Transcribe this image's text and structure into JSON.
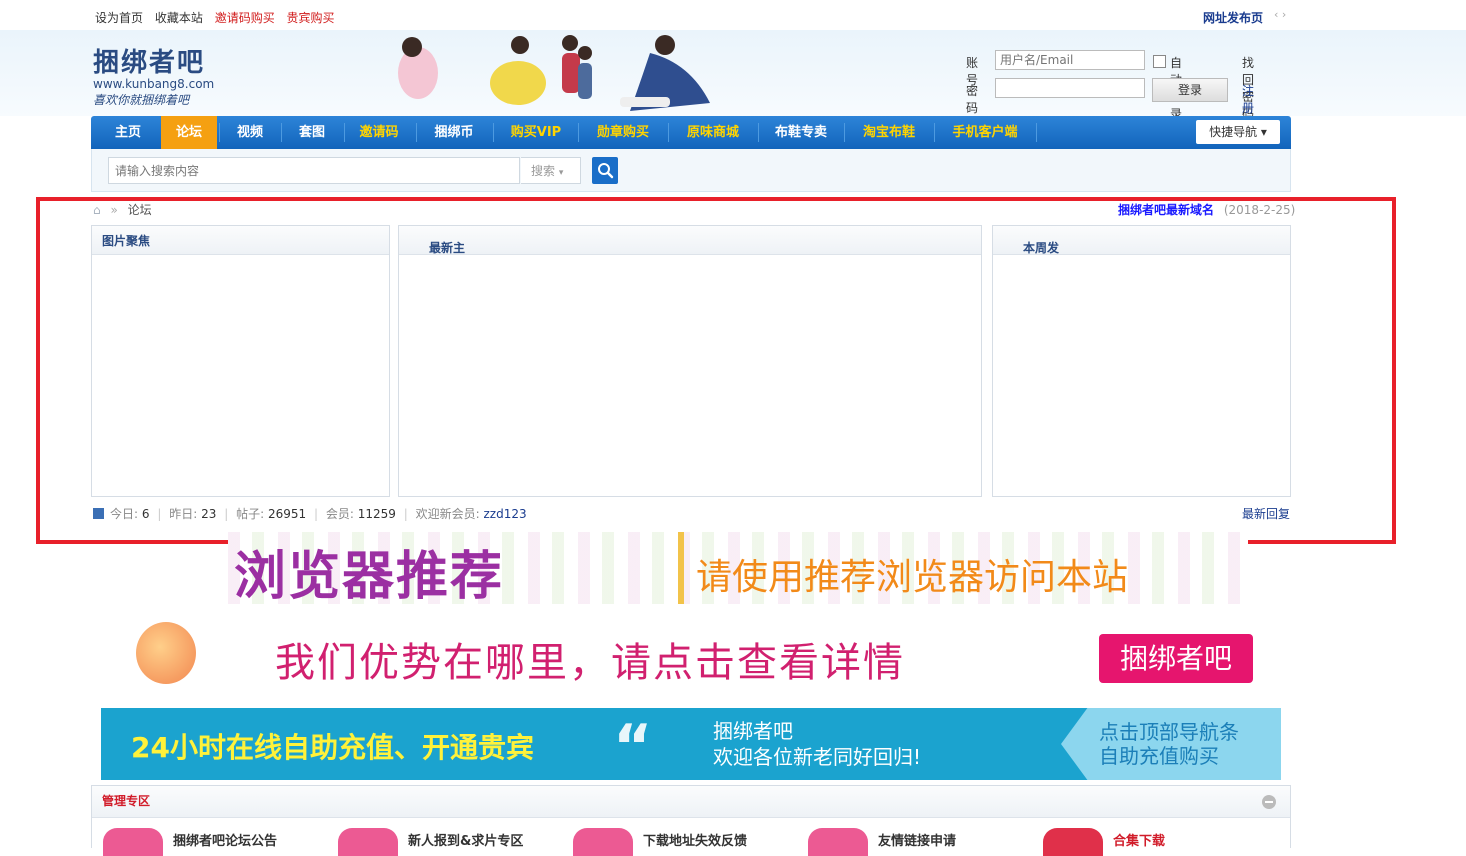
{
  "topbar": {
    "links": [
      "设为首页",
      "收藏本站",
      "邀请码购买",
      "贵宾购买"
    ],
    "right": "网址发布页",
    "arrows": "‹ ›"
  },
  "header": {
    "logo_title": "捆绑者吧",
    "logo_url": "www.kunbang8.com",
    "logo_slogan": "喜欢你就捆绑着吧",
    "login": {
      "account_label": "账号",
      "account_placeholder": "用户名/Email",
      "auto_login": "自动登录",
      "find_password": "找回密码",
      "password_label": "密码",
      "login_button": "登录",
      "register": "注册"
    }
  },
  "nav": {
    "items": [
      "主页",
      "论坛",
      "视频",
      "套图",
      "邀请码",
      "捆绑币",
      "购买VIP",
      "勋章购买",
      "原味商城",
      "布鞋专卖",
      "淘宝布鞋",
      "手机客户端"
    ],
    "quick": "快捷导航",
    "active": "论坛",
    "highlight_color": "#ffd400",
    "active_color": "#f5a011"
  },
  "search": {
    "placeholder": "请输入搜索内容",
    "select": "搜索"
  },
  "breadcrumb": {
    "current": "论坛",
    "notice": "捆绑者吧最新域名",
    "notice_date": "(2018-2-25)"
  },
  "panels": {
    "left": "图片聚焦",
    "middle": "最新主",
    "right": "本周发"
  },
  "stats": {
    "today_label": "今日:",
    "today": "6",
    "yesterday_label": "昨日:",
    "yesterday": "23",
    "posts_label": "帖子:",
    "posts": "26951",
    "members_label": "会员:",
    "members": "11259",
    "welcome_label": "欢迎新会员:",
    "new_member": "zzd123",
    "latest_reply": "最新回复"
  },
  "banners": {
    "b1_left": "浏览器推荐",
    "b1_right": "请使用推荐浏览器访问本站",
    "b2_text": "我们优势在哪里，请点击查看详情",
    "b2_pill": "捆绑者吧",
    "b3_left": "24小时在线自助充值、开通贵宾",
    "b3_quote": "“",
    "b3_mid_1": "捆绑者吧",
    "b3_mid_2": "欢迎各位新老同好回归!",
    "b3_right_1": "点击顶部导航条",
    "b3_right_2": "自助充值购买"
  },
  "manage": {
    "title": "管理专区",
    "forums": [
      "捆绑者吧论坛公告",
      "新人报到&求片专区",
      "下载地址失效反馈",
      "友情链接申请",
      "合集下载"
    ]
  },
  "colors": {
    "nav_blue": "#1a6ec8",
    "highlight_red": "#e8202a"
  }
}
